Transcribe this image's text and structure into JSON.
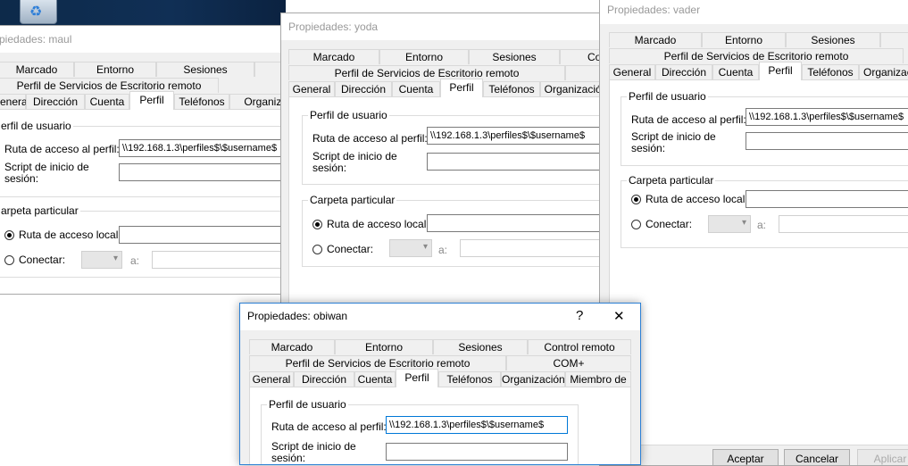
{
  "desktop": {
    "recycle_icon": "recycle-bin-icon"
  },
  "tabs_row1": [
    "Marcado",
    "Entorno",
    "Sesiones",
    "Control remoto"
  ],
  "tabs_row1_partial": "Co",
  "tabs_row2": [
    "Perfil de Servicios de Escritorio remoto",
    "COM+"
  ],
  "tabs_row3": [
    "General",
    "Dirección",
    "Cuenta",
    "Perfil",
    "Teléfonos",
    "Organización",
    "Miembro de"
  ],
  "tabs_row3_partial_gen": "eneral",
  "tabs_row3_partial_org": "Organizaci",
  "groups": {
    "profile": "Perfil de usuario",
    "home": "Carpeta particular"
  },
  "labels": {
    "profile_path": "Ruta de acceso al perfil:",
    "logon_script_1": "Script de inicio de",
    "logon_script_2": "sesión:",
    "local_path": "Ruta de acceso local:",
    "connect": "Conectar:",
    "to": "a:"
  },
  "groups_partial": {
    "profile": "erfil de usuario",
    "home": "arpeta particular"
  },
  "profile_path_value": "\\\\192.168.1.3\\perfiles$\\$username$",
  "windows": {
    "maul": {
      "title": "Propiedades: maul",
      "title_partial": "piedades: maul"
    },
    "yoda": {
      "title": "Propiedades: yoda"
    },
    "vader": {
      "title": "Propiedades: vader"
    },
    "obiwan": {
      "title": "Propiedades: obiwan",
      "help": "?",
      "close": "✕"
    }
  },
  "buttons": {
    "accept": "Aceptar",
    "cancel": "Cancelar",
    "apply": "Aplicar"
  }
}
